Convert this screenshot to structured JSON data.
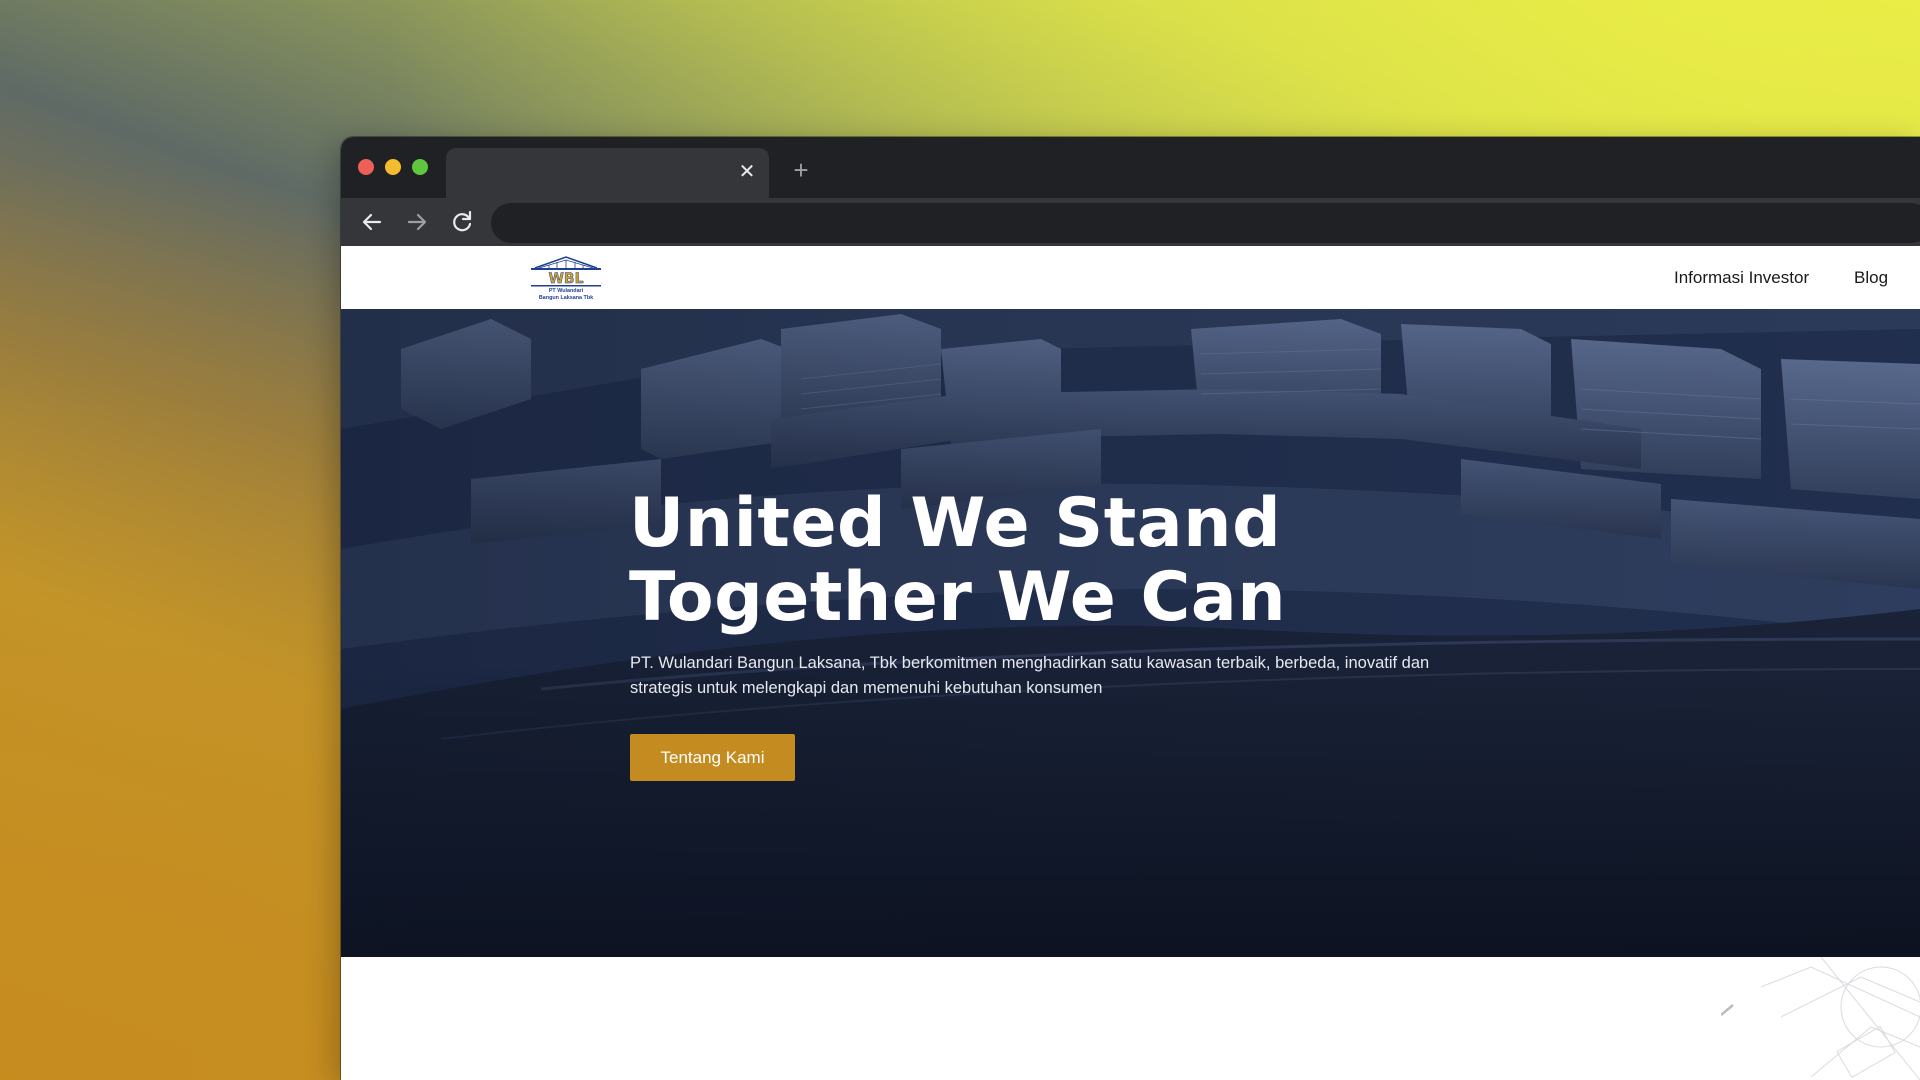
{
  "browser": {
    "tab": {
      "title": "",
      "close_icon": "close-icon"
    },
    "new_tab_icon": "plus-icon",
    "toolbar": {
      "back_icon": "arrow-left-icon",
      "forward_icon": "arrow-right-icon",
      "reload_icon": "reload-icon",
      "address": ""
    },
    "traffic_lights": {
      "close": "#ee5f57",
      "minimize": "#f4bd2f",
      "zoom": "#5fc73f"
    }
  },
  "site": {
    "logo": {
      "mark_text": "WBL",
      "line1": "PT Wulandari",
      "line2": "Bangun Laksana Tbk"
    },
    "nav": [
      {
        "label": "Informasi Investor"
      },
      {
        "label": "Blog"
      }
    ],
    "hero": {
      "title_line1": "United We Stand",
      "title_line2": "Together We Can",
      "description": "PT. Wulandari Bangun Laksana, Tbk berkomitmen menghadirkan satu kawasan terbaik, berbeda, inovatif dan strategis untuk melengkapi dan memenuhi kebutuhan konsumen",
      "cta_label": "Tentang Kami"
    }
  },
  "colors": {
    "accent": "#c38b20",
    "hero_overlay": "#1c2742",
    "logo_gold": "#d4a52a",
    "logo_blue": "#1f3f93"
  }
}
